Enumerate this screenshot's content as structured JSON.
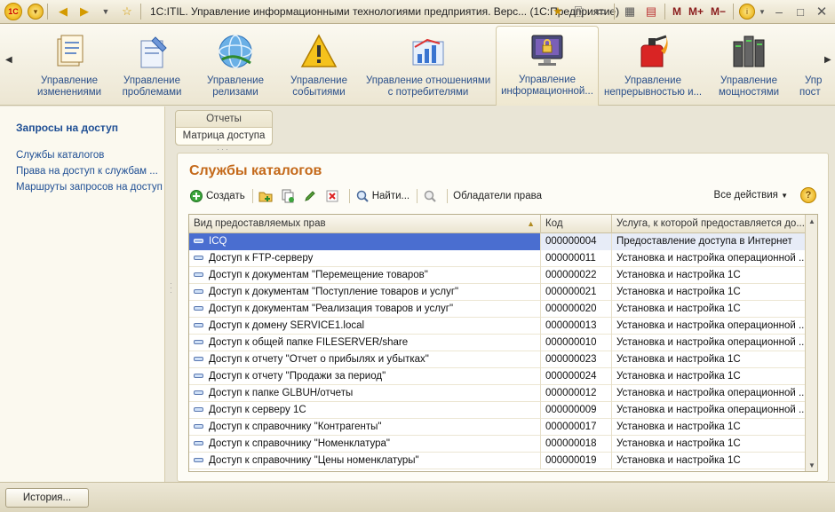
{
  "window": {
    "logo": "1С",
    "title": "1С:ITIL. Управление информационными технологиями предприятия. Верс...  (1С:Предприятие)",
    "m_label": "M",
    "mplus_label": "M+",
    "mminus_label": "M−"
  },
  "ribbon": {
    "items": [
      {
        "label1": "Управление",
        "label2": "изменениями",
        "icon": "changes-icon"
      },
      {
        "label1": "Управление",
        "label2": "проблемами",
        "icon": "problems-icon"
      },
      {
        "label1": "Управление",
        "label2": "релизами",
        "icon": "releases-icon"
      },
      {
        "label1": "Управление",
        "label2": "событиями",
        "icon": "events-icon"
      },
      {
        "label1": "Управление отношениями",
        "label2": "с потребителями",
        "icon": "customers-icon"
      },
      {
        "label1": "Управление",
        "label2": "информационной...",
        "icon": "security-icon"
      },
      {
        "label1": "Управление",
        "label2": "непрерывностью и...",
        "icon": "continuity-icon"
      },
      {
        "label1": "Управление",
        "label2": "мощностями",
        "icon": "capacity-icon"
      },
      {
        "label1": "Упр",
        "label2": "пост",
        "icon": "more-icon"
      }
    ]
  },
  "leftpanel": {
    "title": "Запросы на доступ",
    "links": [
      "Службы каталогов",
      "Права на доступ к службам ...",
      "Маршруты запросов на доступ"
    ]
  },
  "subtabs": {
    "top": "Отчеты",
    "selected": "Матрица доступа"
  },
  "main": {
    "title": "Службы каталогов",
    "toolbar": {
      "create": "Создать",
      "find": "Найти...",
      "owners": "Обладатели права",
      "all_actions": "Все действия",
      "help": "?"
    },
    "table": {
      "headers": [
        "Вид предоставляемых прав",
        "Код",
        "Услуга, к которой предоставляется до..."
      ],
      "rows": [
        {
          "name": "ICQ",
          "code": "000000004",
          "service": "Предоставление доступа в Интернет"
        },
        {
          "name": "Доступ к FTP-серверу",
          "code": "000000011",
          "service": "Установка и настройка операционной ..."
        },
        {
          "name": "Доступ к документам \"Перемещение товаров\"",
          "code": "000000022",
          "service": "Установка и настройка 1С"
        },
        {
          "name": "Доступ к документам \"Поступление товаров и услуг\"",
          "code": "000000021",
          "service": "Установка и настройка 1С"
        },
        {
          "name": "Доступ к документам \"Реализация товаров и услуг\"",
          "code": "000000020",
          "service": "Установка и настройка 1С"
        },
        {
          "name": "Доступ к домену SERVICE1.local",
          "code": "000000013",
          "service": "Установка и настройка операционной ..."
        },
        {
          "name": "Доступ к общей папке FILESERVER/share",
          "code": "000000010",
          "service": "Установка и настройка операционной ..."
        },
        {
          "name": "Доступ к отчету \"Отчет о прибылях и убытках\"",
          "code": "000000023",
          "service": "Установка и настройка 1С"
        },
        {
          "name": "Доступ к отчету \"Продажи за период\"",
          "code": "000000024",
          "service": "Установка и настройка 1С"
        },
        {
          "name": "Доступ к папке GLBUH/отчеты",
          "code": "000000012",
          "service": "Установка и настройка операционной ..."
        },
        {
          "name": "Доступ к серверу 1С",
          "code": "000000009",
          "service": "Установка и настройка операционной ..."
        },
        {
          "name": "Доступ к справочнику \"Контрагенты\"",
          "code": "000000017",
          "service": "Установка и настройка 1С"
        },
        {
          "name": "Доступ к справочнику \"Номенклатура\"",
          "code": "000000018",
          "service": "Установка и настройка 1С"
        },
        {
          "name": "Доступ к справочнику \"Цены номенклатуры\"",
          "code": "000000019",
          "service": "Установка и настройка 1С"
        }
      ]
    }
  },
  "bottom": {
    "history": "История..."
  }
}
